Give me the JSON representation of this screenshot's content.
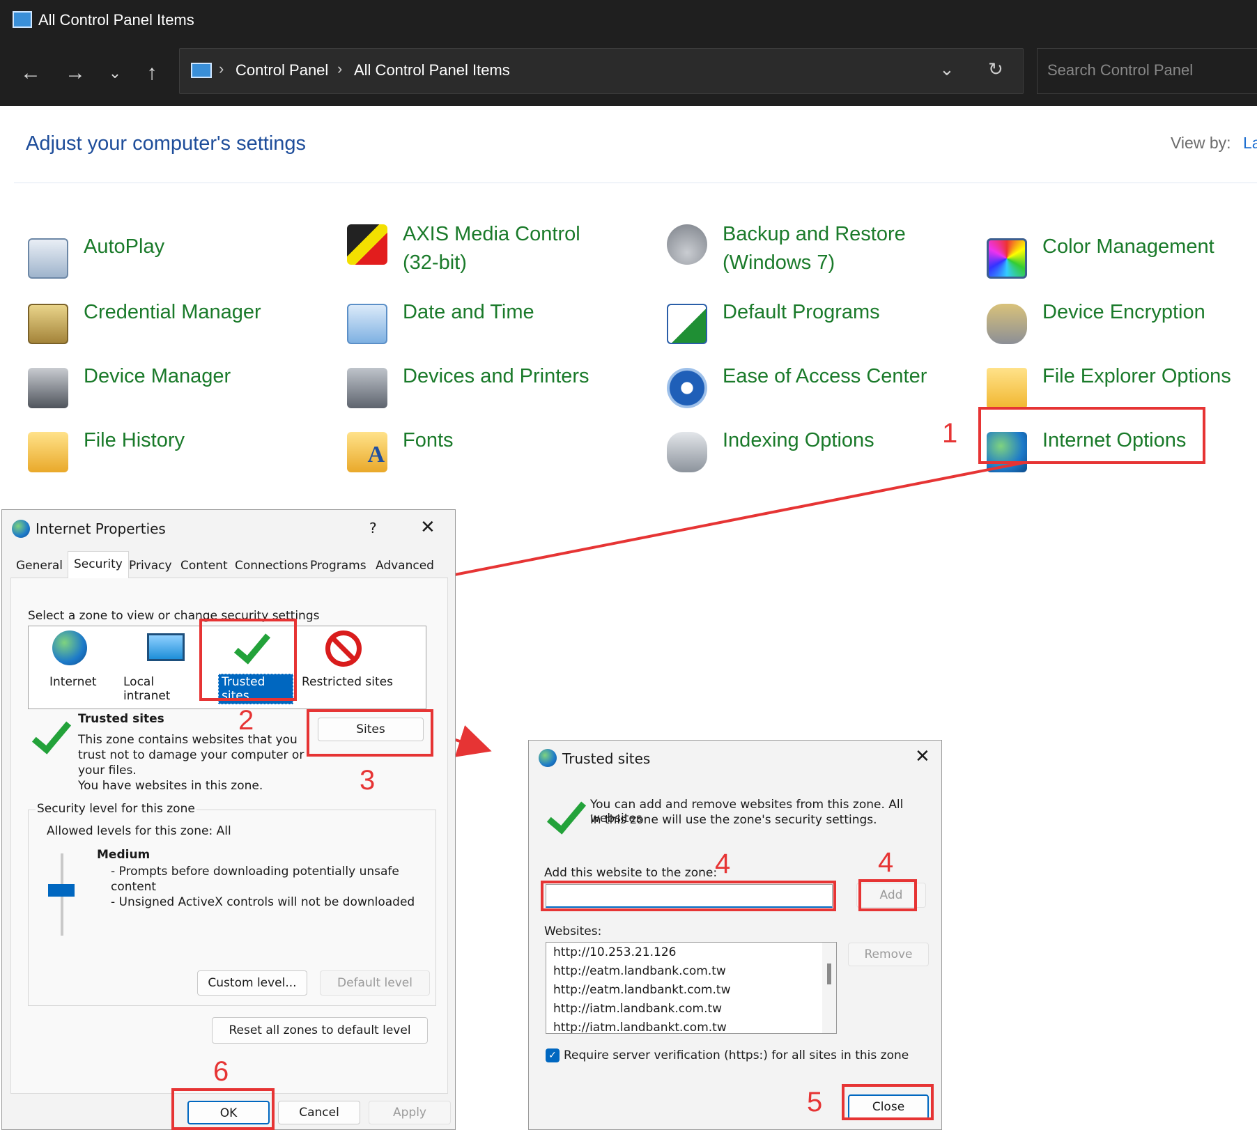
{
  "control_panel": {
    "window_title": "All Control Panel Items",
    "breadcrumb": [
      "Control Panel",
      "All Control Panel Items"
    ],
    "search_placeholder": "Search Control Panel",
    "heading": "Adjust your computer's settings",
    "view_by_label": "View by:",
    "view_by_value": "La",
    "items": [
      {
        "label": "AutoPlay",
        "icon": "autoplay-icon"
      },
      {
        "label": "AXIS Media Control (32-bit)",
        "label_line1": "AXIS Media Control",
        "label_line2": "(32-bit)",
        "icon": "axis-media-icon"
      },
      {
        "label": "Backup and Restore (Windows 7)",
        "label_line1": "Backup and Restore",
        "label_line2": "(Windows 7)",
        "icon": "backup-icon"
      },
      {
        "label": "Color Management",
        "icon": "color-management-icon"
      },
      {
        "label": "Credential Manager",
        "icon": "credential-icon"
      },
      {
        "label": "Date and Time",
        "icon": "clock-icon"
      },
      {
        "label": "Default Programs",
        "icon": "default-programs-icon"
      },
      {
        "label": "Device Encryption",
        "icon": "key-icon"
      },
      {
        "label": "Device Manager",
        "icon": "device-manager-icon"
      },
      {
        "label": "Devices and Printers",
        "icon": "printer-icon"
      },
      {
        "label": "Ease of Access Center",
        "icon": "accessibility-icon"
      },
      {
        "label": "File Explorer Options",
        "icon": "folder-options-icon"
      },
      {
        "label": "File History",
        "icon": "file-history-icon"
      },
      {
        "label": "Fonts",
        "icon": "fonts-icon"
      },
      {
        "label": "Indexing Options",
        "icon": "indexing-icon"
      },
      {
        "label": "Internet Options",
        "icon": "globe-icon"
      }
    ]
  },
  "annotations": [
    "1",
    "2",
    "3",
    "4",
    "4",
    "5",
    "6"
  ],
  "internet_properties": {
    "title": "Internet Properties",
    "help": "?",
    "tabs": [
      "General",
      "Security",
      "Privacy",
      "Content",
      "Connections",
      "Programs",
      "Advanced"
    ],
    "zone_prompt": "Select a zone to view or change security settings",
    "zones": [
      "Internet",
      "Local intranet",
      "Trusted sites",
      "Restricted sites"
    ],
    "zone_title": "Trusted sites",
    "zone_desc": [
      "This zone contains websites that you",
      "trust not to damage your computer or",
      "your files.",
      "You have websites in this zone."
    ],
    "sites_button": "Sites",
    "security_group": "Security level for this zone",
    "allowed_levels": "Allowed levels for this zone: All",
    "level_name": "Medium",
    "level_desc": [
      "- Prompts before downloading potentially unsafe",
      "content",
      "- Unsigned ActiveX controls will not be downloaded"
    ],
    "custom_level": "Custom level...",
    "default_level": "Default level",
    "reset_all": "Reset all zones to default level",
    "ok": "OK",
    "cancel": "Cancel",
    "apply": "Apply"
  },
  "trusted_sites": {
    "title": "Trusted sites",
    "info": [
      "You can add and remove websites from this zone. All websites",
      "in this zone will use the zone's security settings."
    ],
    "add_label": "Add this website to the zone:",
    "add_value": "",
    "add_button": "Add",
    "websites_label": "Websites:",
    "websites": [
      "http://10.253.21.126",
      "http://eatm.landbank.com.tw",
      "http://eatm.landbankt.com.tw",
      "http://iatm.landbank.com.tw",
      "http://iatm.landbankt.com.tw"
    ],
    "remove_button": "Remove",
    "require_https": "Require server verification (https:) for all sites in this zone",
    "require_https_checked": true,
    "close_button": "Close"
  },
  "colors": {
    "accent": "#0067c0",
    "annotation": "#e63434",
    "link_green": "#1a7a2a"
  }
}
